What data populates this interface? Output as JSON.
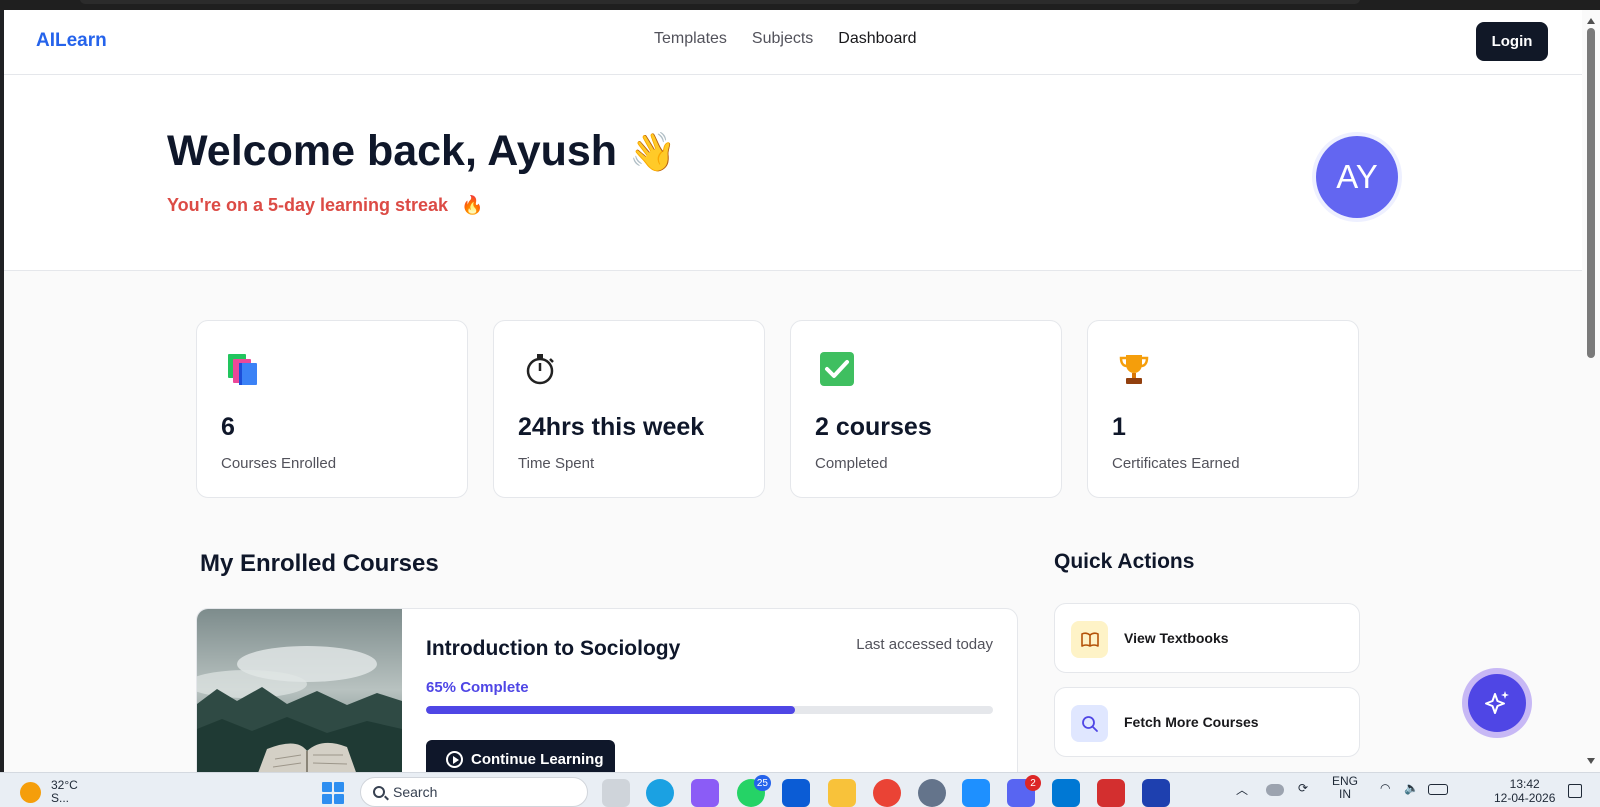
{
  "navbar": {
    "brand": "AILearn",
    "links": [
      "Templates",
      "Subjects",
      "Dashboard"
    ],
    "login_label": "Login"
  },
  "hero": {
    "title": "Welcome back, Ayush",
    "wave_emoji": "👋",
    "subtitle": "You're on a 5-day learning streak",
    "streak_emoji": "🔥",
    "avatar_initials": "AY"
  },
  "stats": [
    {
      "icon": "books-icon",
      "value": "6",
      "label": "Courses Enrolled"
    },
    {
      "icon": "stopwatch-icon",
      "value": "24hrs this week",
      "label": "Time Spent"
    },
    {
      "icon": "checkmark-icon",
      "value": "2 courses",
      "label": "Completed"
    },
    {
      "icon": "trophy-icon",
      "value": "1",
      "label": "Certificates Earned"
    }
  ],
  "enrolled": {
    "heading": "My Enrolled Courses",
    "courses": [
      {
        "title": "Introduction to Sociology",
        "last_accessed": "Last accessed today",
        "progress_label": "65% Complete",
        "progress": 0.65,
        "button_label": "Continue Learning"
      }
    ]
  },
  "quick_actions": {
    "heading": "Quick Actions",
    "items": [
      {
        "label": "View Textbooks",
        "icon": "book-open-icon"
      },
      {
        "label": "Fetch More Courses",
        "icon": "search-icon"
      }
    ]
  },
  "colors": {
    "brand": "#2563eb",
    "streak": "#dc4b45",
    "accent": "#4f46e5",
    "avatar": "#6366f1"
  },
  "taskbar": {
    "weather_temp": "32°C",
    "weather_desc": "S...",
    "search_placeholder": "Search",
    "whatsapp_badge": "25",
    "discord_badge": "2",
    "language": "ENG",
    "language_region": "IN",
    "time": "13:42",
    "date": "12-04-2026"
  }
}
